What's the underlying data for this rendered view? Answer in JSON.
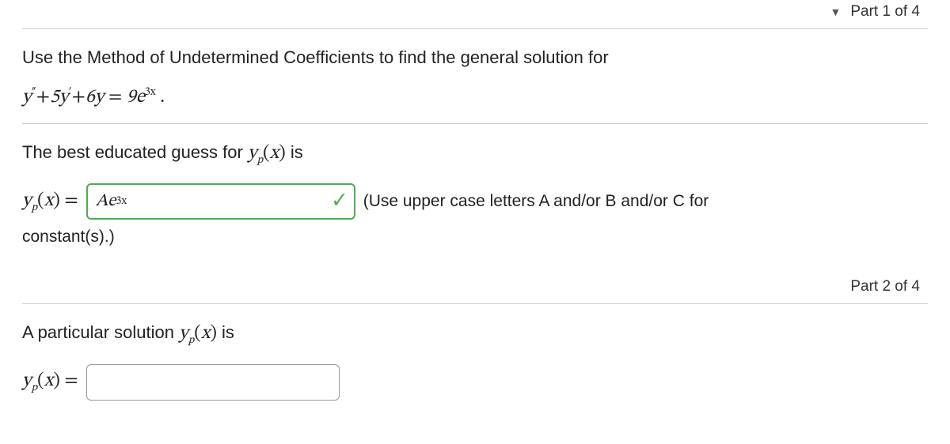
{
  "part1": {
    "label": "Part 1 of 4",
    "question_text": "Use the Method of Undetermined Coefficients to find the general solution for",
    "equation_text": "y″+5y′+6y = 9e^{3x} .",
    "guess_prompt_pre": "The best educated guess for ",
    "guess_prompt_post": " is",
    "yp_prefix": "y_p(x) =",
    "answer_value": "Ae^{3x}",
    "hint_part1": "(Use upper case letters A and/or B and/or C for",
    "hint_part2": "constant(s).)"
  },
  "part2": {
    "label": "Part 2 of 4",
    "prompt_pre": "A particular solution ",
    "prompt_post": " is",
    "yp_prefix": "y_p(x) =",
    "answer_value": ""
  }
}
